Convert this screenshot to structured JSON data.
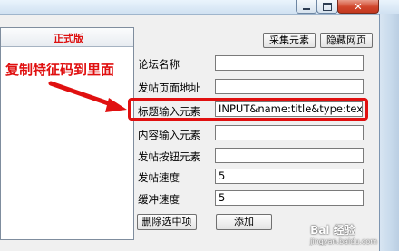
{
  "window": {
    "minimize_icon": "minimize-icon",
    "maximize_icon": "maximize-icon",
    "close_icon": "close-icon",
    "close_glyph": "✕"
  },
  "left_panel": {
    "edition_label": "正式版"
  },
  "annotation": {
    "text": "复制特征码到里面",
    "color": "#e01010"
  },
  "toolbar": {
    "collect_button": "采集元素",
    "hide_page_button": "隐藏网页"
  },
  "form": {
    "fields": [
      {
        "label": "论坛名称",
        "value": ""
      },
      {
        "label": "发帖页面地址",
        "value": ""
      },
      {
        "label": "标题输入元素",
        "value": "INPUT&name:title&type:text"
      },
      {
        "label": "内容输入元素",
        "value": ""
      },
      {
        "label": "发帖按钮元素",
        "value": ""
      },
      {
        "label": "发帖速度",
        "value": "5"
      },
      {
        "label": "缓冲速度",
        "value": "5"
      }
    ],
    "delete_button": "删除选中项",
    "add_button": "添加"
  },
  "watermark": {
    "text": "Bai 经验",
    "sub": "jingyan.baidu.com"
  }
}
